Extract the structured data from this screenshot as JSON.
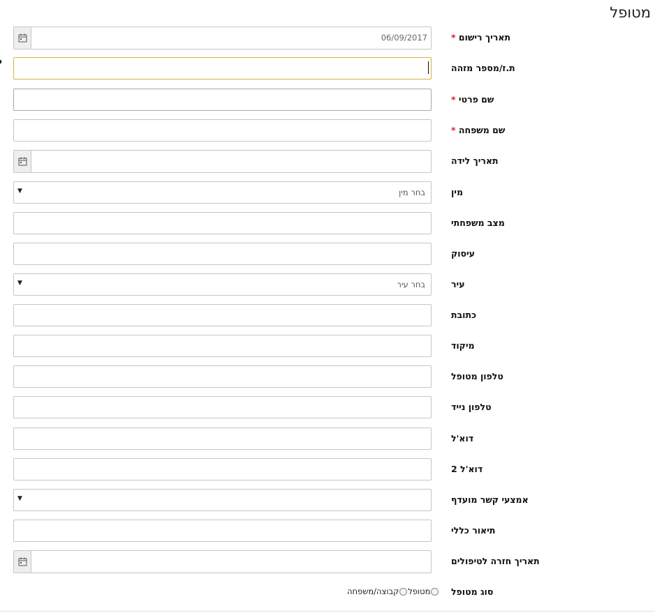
{
  "title": "מטופל",
  "required_mark": "*",
  "fields": {
    "registration_date": {
      "label": "תאריך רישום",
      "value": "06/09/2017"
    },
    "id_number": {
      "label": "ת.ז/מספר מזהה"
    },
    "first_name": {
      "label": "שם פרטי"
    },
    "last_name": {
      "label": "שם משפחה"
    },
    "birth_date": {
      "label": "תאריך לידה"
    },
    "gender": {
      "label": "מין",
      "selected": "בחר מין"
    },
    "marital_status": {
      "label": "מצב משפחתי"
    },
    "occupation": {
      "label": "עיסוק"
    },
    "city": {
      "label": "עיר",
      "selected": "בחר עיר"
    },
    "address": {
      "label": "כתובת"
    },
    "zip": {
      "label": "מיקוד"
    },
    "patient_phone": {
      "label": "טלפון מטופל"
    },
    "mobile_phone": {
      "label": "טלפון נייד"
    },
    "email": {
      "label": "דוא'ל"
    },
    "email2": {
      "label": "דוא'ל 2"
    },
    "preferred_contact": {
      "label": "אמצעי קשר מועדף",
      "selected": ""
    },
    "general_description": {
      "label": "תיאור כללי"
    },
    "treatment_return_date": {
      "label": "תאריך חזרה לטיפולים"
    },
    "patient_type": {
      "label": "סוג מטופל",
      "options": [
        "מטופל",
        "קבוצה/משפחה"
      ]
    }
  },
  "icons": {
    "calendar": "calendar-icon",
    "dropdown": "caret-down-icon",
    "help": "help-icon"
  }
}
